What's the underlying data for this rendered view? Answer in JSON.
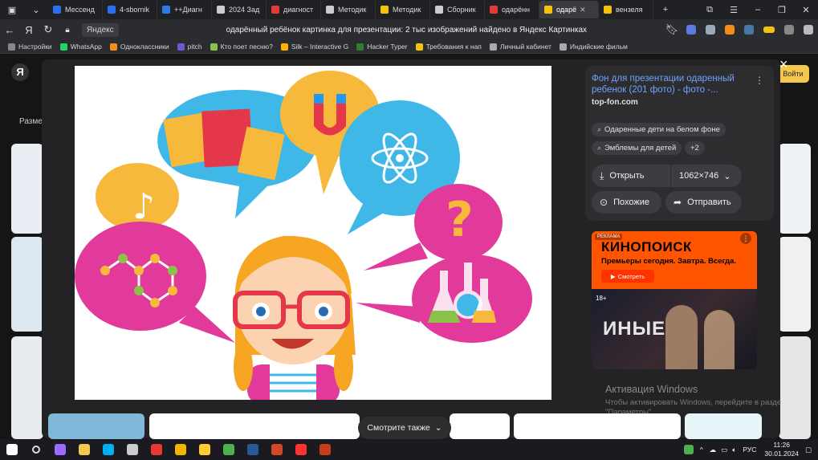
{
  "tabs": [
    {
      "label": "Мессенд",
      "color": "#2a6ff2"
    },
    {
      "label": "4-sbornik",
      "color": "#2a6ff2"
    },
    {
      "label": "++Диагн",
      "color": "#2c7be5"
    },
    {
      "label": "2024 Зад",
      "color": "#cccccc"
    },
    {
      "label": "диагност",
      "color": "#e53935"
    },
    {
      "label": "Методик",
      "color": "#cccccc"
    },
    {
      "label": "Методик",
      "color": "#f4c20d"
    },
    {
      "label": "Сборник",
      "color": "#cccccc"
    },
    {
      "label": "одарённ",
      "color": "#e53935"
    },
    {
      "label": "одарё",
      "color": "#f4c20d",
      "active": true
    },
    {
      "label": "вензеля",
      "color": "#f4c20d"
    }
  ],
  "address": {
    "site_label": "Яндекс",
    "page_title": "одарённый ребёнок картинка для презентации: 2 тыс изображений найдено в Яндекс Картинках"
  },
  "bookmarks": [
    {
      "label": "Настройки",
      "color": "#888"
    },
    {
      "label": "WhatsApp",
      "color": "#25d366"
    },
    {
      "label": "Одноклассники",
      "color": "#f28c1b"
    },
    {
      "label": "pitch",
      "color": "#6a5acd"
    },
    {
      "label": "Кто поет песню? ",
      "color": "#8bc34a"
    },
    {
      "label": "Silk – Interactive G",
      "color": "#ffb300"
    },
    {
      "label": "Hacker Typer",
      "color": "#2e7d32"
    },
    {
      "label": "Требования к нап",
      "color": "#f4c20d"
    },
    {
      "label": "Личный кабинет",
      "color": "#aaa"
    },
    {
      "label": "Индийские фильм",
      "color": "#aaa"
    }
  ],
  "page": {
    "logo": "Я",
    "filter_label": "Разме",
    "login_label": "Войти"
  },
  "viewer": {
    "close_icon": "×",
    "source_title": "Фон для презентации одаренный ребенок (201 фото) - фото -...",
    "source_domain": "top-fon.com",
    "more_icon": "⋮",
    "chips": [
      "Одаренные дети на белом фоне",
      "Эмблемы для детей",
      "+2"
    ],
    "open_label": "Открыть",
    "size_label": "1062×746",
    "similar_label": "Похожие",
    "share_label": "Отправить",
    "see_also_label": "Смотрите также"
  },
  "ad": {
    "badge": "РЕКЛАМА",
    "brand": "КИНОПОИСК",
    "tagline": "Премьеры сегодня. Завтра. Всегда.",
    "cta": "Смотреть",
    "age": "18+",
    "movie_title": "ИНЫЕ"
  },
  "watermark": {
    "title": "Активация Windows",
    "subtitle": "Чтобы активировать Windows, перейдите в разде \"Параметры\"."
  },
  "tray": {
    "lang": "РУС",
    "time": "11:26",
    "date": "30.01.2024"
  },
  "taskbar_icons": [
    {
      "name": "windows-start-icon",
      "color": "#ffffff"
    },
    {
      "name": "search-icon",
      "color": "#dddddd"
    },
    {
      "name": "alice-icon",
      "color": "#9a6bff"
    },
    {
      "name": "file-explorer-icon",
      "color": "#f2c94c"
    },
    {
      "name": "skype-icon",
      "color": "#00aff0"
    },
    {
      "name": "notepad-icon",
      "color": "#cccccc"
    },
    {
      "name": "yandex-icon",
      "color": "#e53935"
    },
    {
      "name": "media-player-icon",
      "color": "#f4b400"
    },
    {
      "name": "eye-icon",
      "color": "#ffcc33"
    },
    {
      "name": "chrome-icon",
      "color": "#4caf50"
    },
    {
      "name": "word-icon",
      "color": "#2b579a"
    },
    {
      "name": "presentation-icon",
      "color": "#d24726"
    },
    {
      "name": "yandex-browser-icon",
      "color": "#ff3333"
    },
    {
      "name": "powerpoint-icon",
      "color": "#c43e1c"
    }
  ]
}
